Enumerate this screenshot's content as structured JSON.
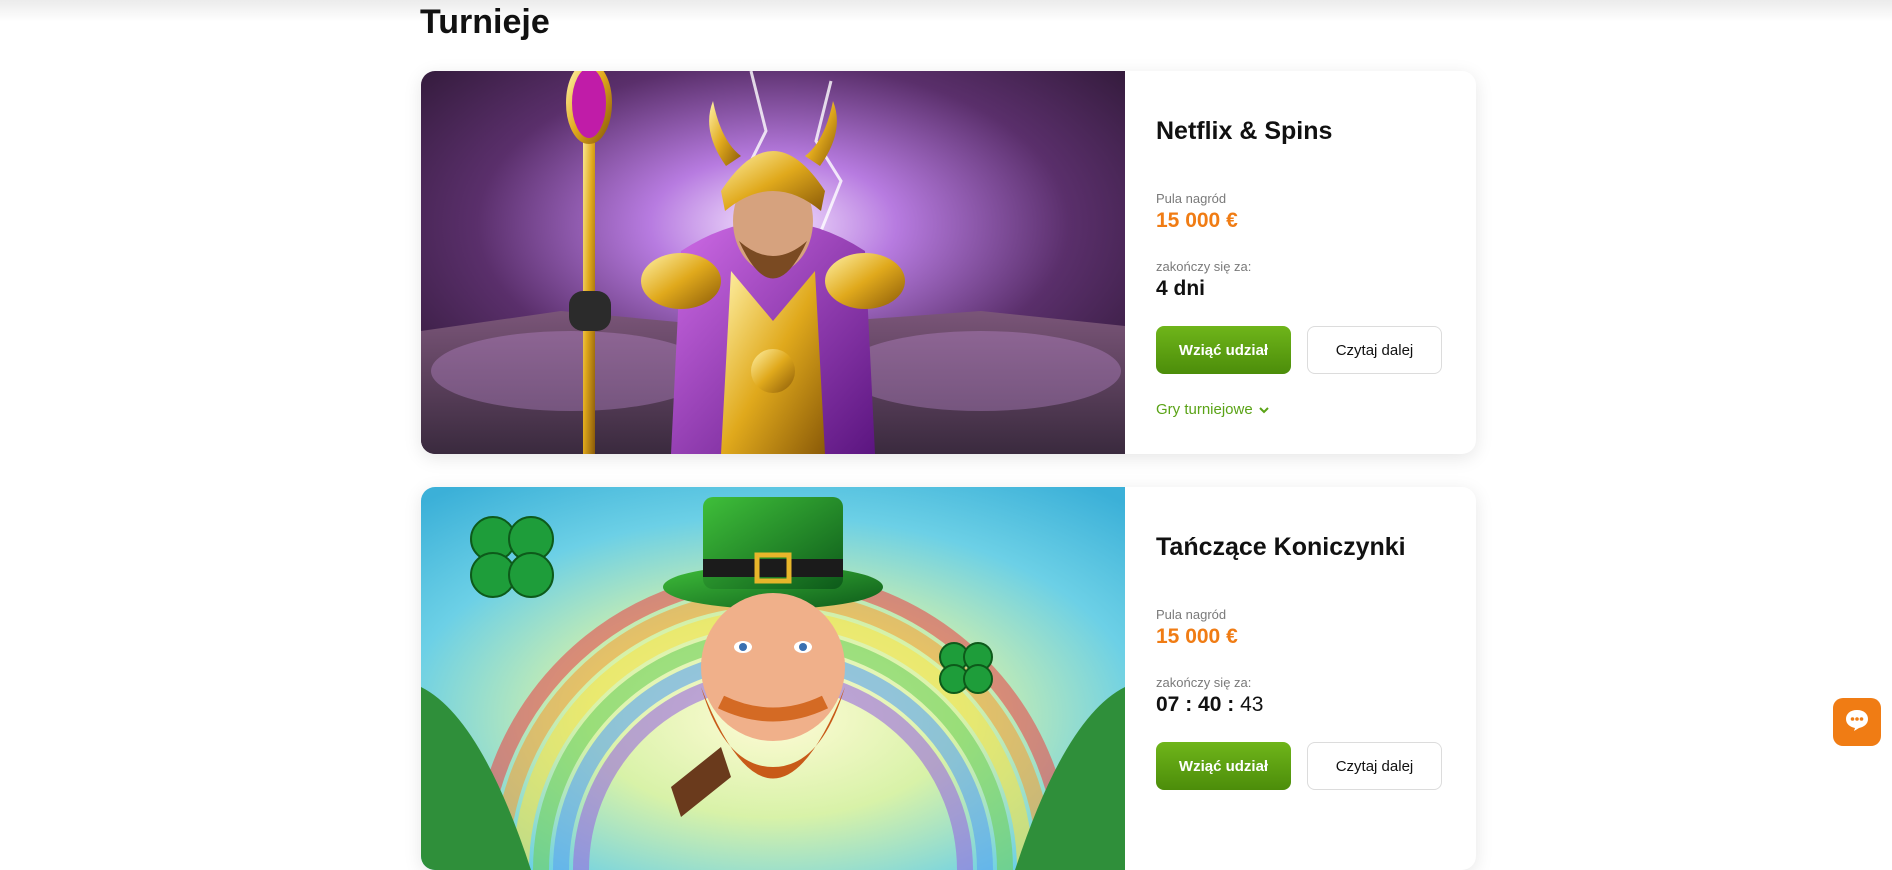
{
  "page": {
    "title": "Turnieje"
  },
  "tournaments": [
    {
      "name": "Netflix & Spins",
      "prize_label": "Pula nagród",
      "prize": "15 000 €",
      "end_label": "zakończy się za:",
      "end_value": "4 dni",
      "join_label": "Wziąć udział",
      "more_label": "Czytaj dalej",
      "games_label": "Gry turniejowe"
    },
    {
      "name": "Tańczące Koniczynki",
      "prize_label": "Pula nagród",
      "prize": "15 000 €",
      "end_label": "zakończy się za:",
      "countdown": {
        "hours": "07",
        "minutes": "40",
        "seconds": "43",
        "sep": ":"
      },
      "join_label": "Wziąć udział",
      "more_label": "Czytaj dalej"
    }
  ],
  "colors": {
    "accent_orange": "#f07c14",
    "accent_green": "#5aa316"
  },
  "icons": {
    "chat": "chat-bubble-icon",
    "chevron": "chevron-down-icon"
  }
}
